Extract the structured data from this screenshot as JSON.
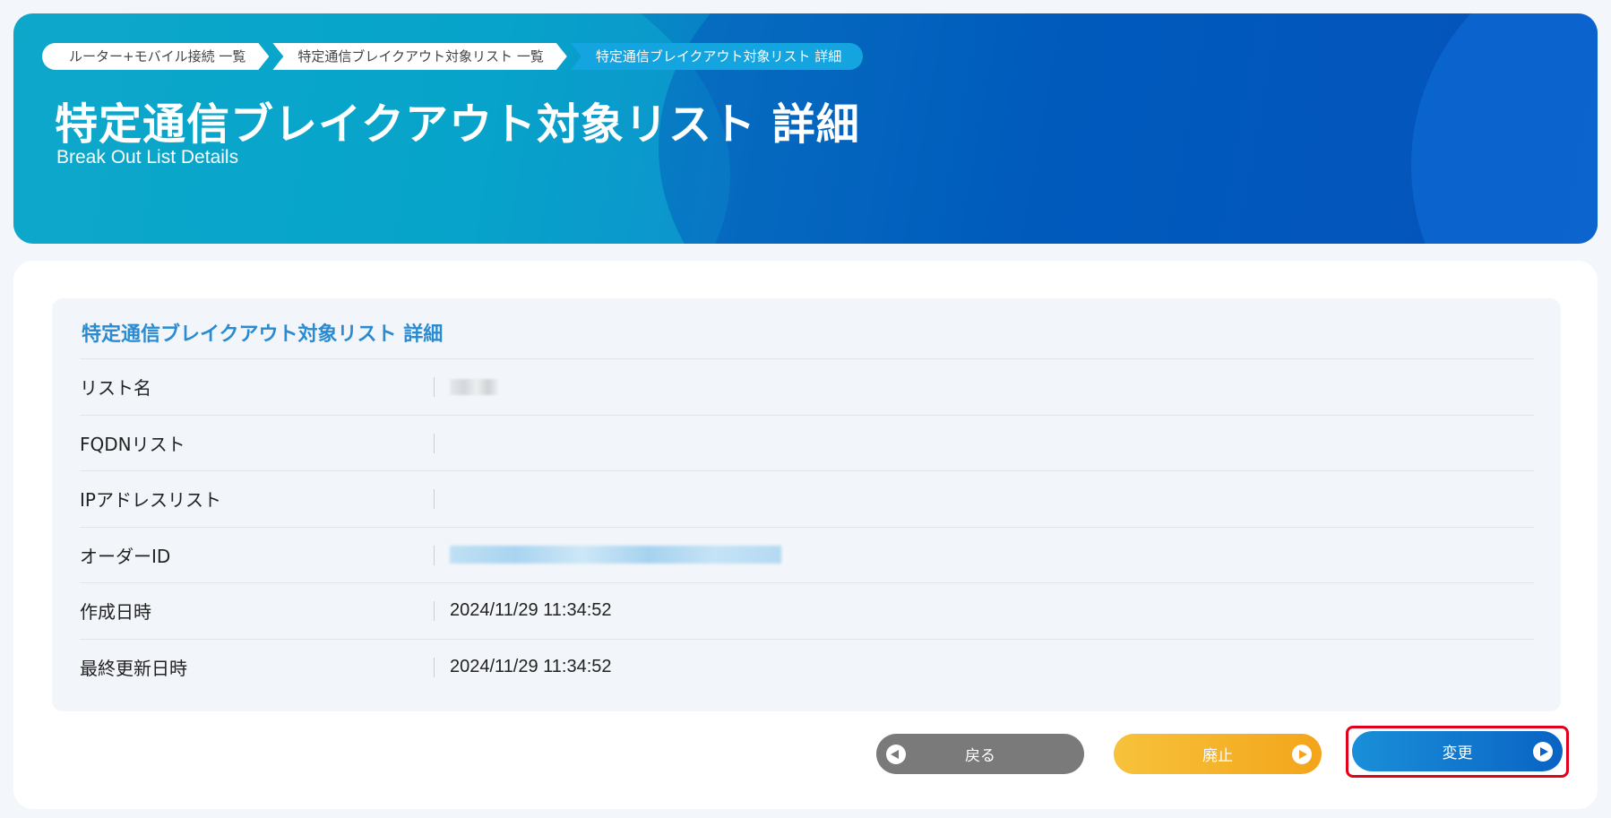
{
  "breadcrumb": {
    "items": [
      {
        "label": "ルーター+モバイル接続 一覧"
      },
      {
        "label": "特定通信ブレイクアウト対象リスト 一覧"
      },
      {
        "label": "特定通信ブレイクアウト対象リスト 詳細"
      }
    ]
  },
  "header": {
    "title": "特定通信ブレイクアウト対象リスト 詳細",
    "subtitle": "Break Out List Details"
  },
  "panel": {
    "title": "特定通信ブレイクアウト対象リスト 詳細",
    "rows": [
      {
        "label": "リスト名",
        "value": ""
      },
      {
        "label": "FQDNリスト",
        "value": ""
      },
      {
        "label": "IPアドレスリスト",
        "value": ""
      },
      {
        "label": "オーダーID",
        "value": ""
      },
      {
        "label": "作成日時",
        "value": "2024/11/29 11:34:52"
      },
      {
        "label": "最終更新日時",
        "value": "2024/11/29 11:34:52"
      }
    ]
  },
  "buttons": {
    "back": "戻る",
    "abolish": "廃止",
    "change": "変更"
  },
  "colors": {
    "accent_blue": "#2a8bd2",
    "highlight_red": "#e3001b",
    "back_gray": "#7a7a7a",
    "abolish_orange": "#f3a51b",
    "change_blue": "#0a63c4"
  }
}
